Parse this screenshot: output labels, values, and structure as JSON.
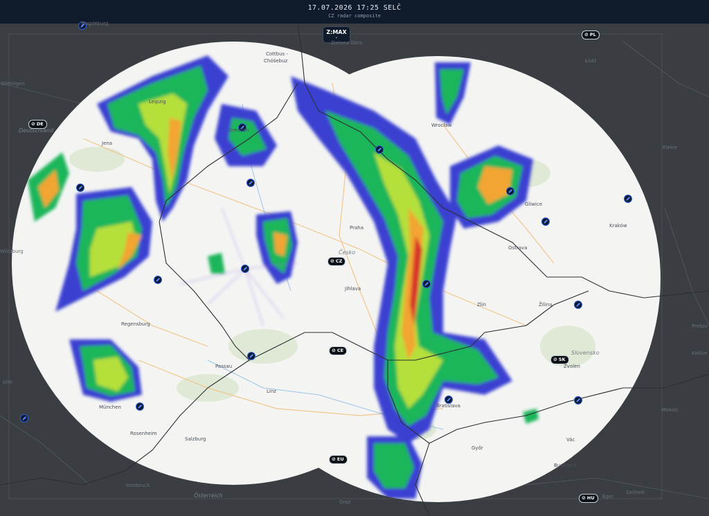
{
  "header": {
    "timestamp": "17.07.2026 17:25 SELČ",
    "subtitle": "CZ radar composite"
  },
  "product_selector": {
    "label": "Z:MAX",
    "chevron": "⌄"
  },
  "country_badges": [
    {
      "code": "PL"
    },
    {
      "code": "DE"
    },
    {
      "code": "CZ"
    },
    {
      "code": "CE"
    },
    {
      "code": "SK"
    },
    {
      "code": "EU"
    },
    {
      "code": "HU"
    }
  ],
  "radar_site_count": 17,
  "place_labels": [
    "Magdeburg",
    "Cottbus -",
    "Chóśebuz",
    "Zielona Góra",
    "Łódź",
    "Göttingen",
    "Leipzig",
    "Deutschland",
    "Jena",
    "Dresden",
    "Wrocław",
    "Kielce",
    "Gliwice",
    "Kraków",
    "Würzburg",
    "Praha",
    "Česko",
    "Ostrava",
    "Jihlava",
    "Zlín",
    "Žilina",
    "Regensburg",
    "Prešov",
    "Košice",
    "Slovensko",
    "Zvolen",
    "Passau",
    "Ulm",
    "Linz",
    "München",
    "Bratislava",
    "Miskolc",
    "Rosenheim",
    "Salzburg",
    "Győr",
    "Vác",
    "Budapest",
    "Innsbruck",
    "Österreich",
    "Graz",
    "Eger",
    "Szolnok"
  ],
  "colors": {
    "background": "#3a3d42",
    "header": "#0f1a2a",
    "coverage": "#f4f5f3",
    "radar_site": "#2a5bd7"
  }
}
